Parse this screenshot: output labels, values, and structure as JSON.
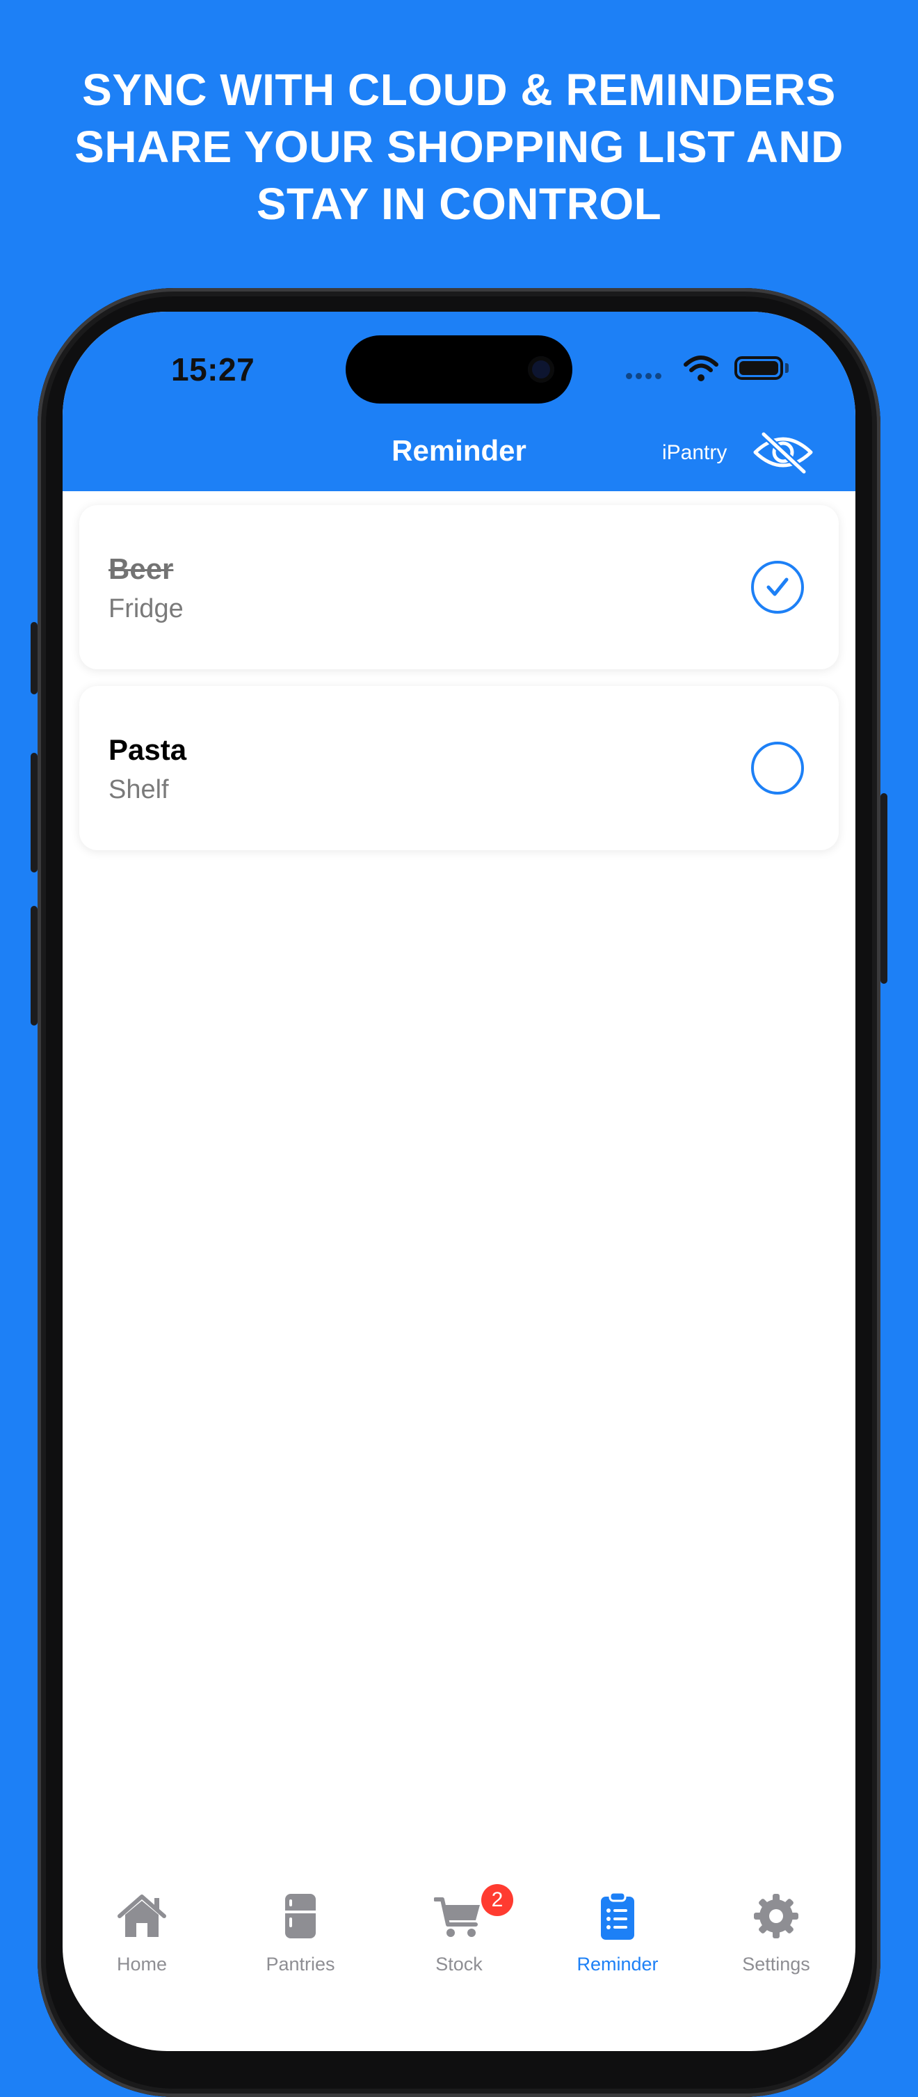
{
  "headline": {
    "line1": "SYNC WITH CLOUD & REMINDERS",
    "line2": "SHARE YOUR SHOPPING LIST AND",
    "line3": "STAY IN CONTROL"
  },
  "status_bar": {
    "time": "15:27"
  },
  "nav": {
    "title": "Reminder",
    "brand": "iPantry",
    "visibility_icon": "eye-slash-icon"
  },
  "reminders": [
    {
      "title": "Beer",
      "location": "Fridge",
      "done": true
    },
    {
      "title": "Pasta",
      "location": "Shelf",
      "done": false
    }
  ],
  "tabs": [
    {
      "label": "Home",
      "icon": "house-icon",
      "active": false
    },
    {
      "label": "Pantries",
      "icon": "fridge-icon",
      "active": false
    },
    {
      "label": "Stock",
      "icon": "cart-icon",
      "active": false,
      "badge": "2"
    },
    {
      "label": "Reminder",
      "icon": "clipboard-list-icon",
      "active": true
    },
    {
      "label": "Settings",
      "icon": "gear-icon",
      "active": false
    }
  ],
  "colors": {
    "accent": "#1d80f6",
    "badge": "#ff3b30",
    "inactive": "#8e8e93"
  }
}
